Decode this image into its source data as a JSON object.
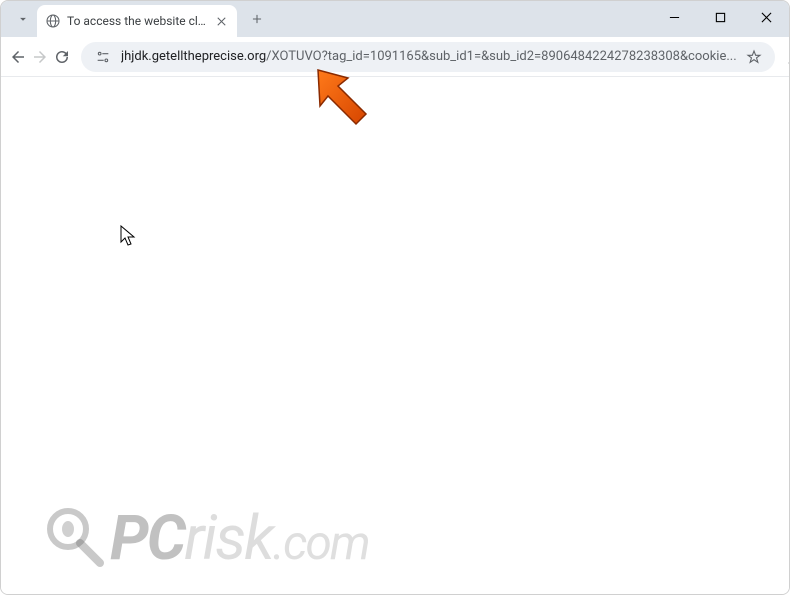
{
  "tab": {
    "title": "To access the website click the"
  },
  "url": {
    "domain": "jhjdk.getelltheprecise.org",
    "path": "/XOTUVO?tag_id=1091165&sub_id1=&sub_id2=8906484224278238308&cookie..."
  },
  "watermark": {
    "pc": "PC",
    "risk": "risk",
    "dotcom": ".com"
  }
}
